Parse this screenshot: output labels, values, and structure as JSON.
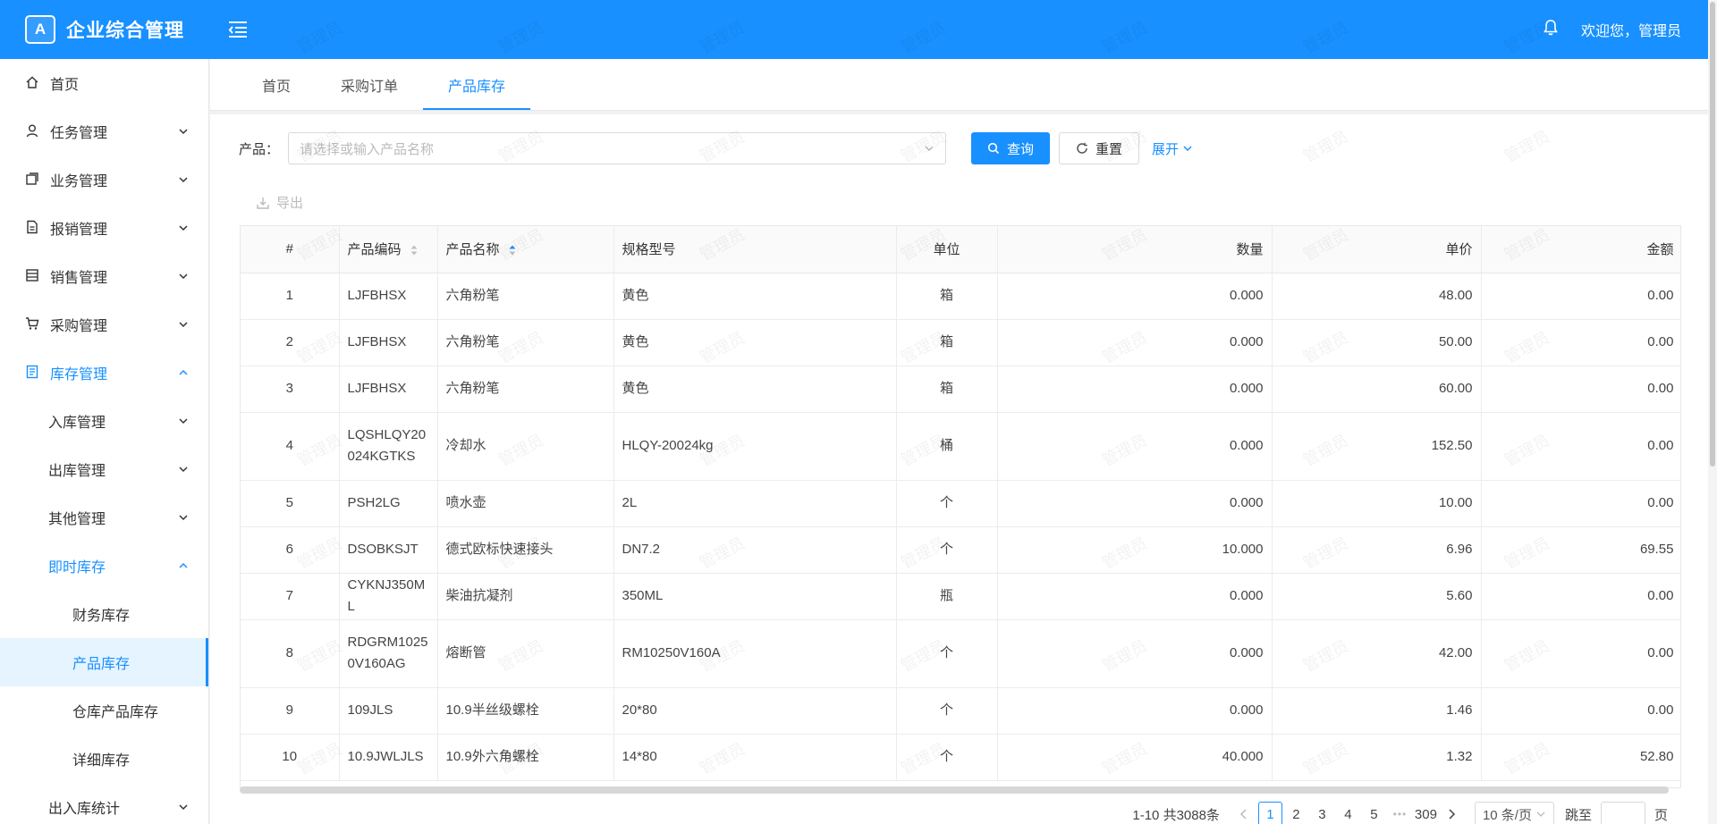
{
  "header": {
    "logo_badge": "A",
    "title": "企业综合管理",
    "welcome": "欢迎您，管理员"
  },
  "sidebar": {
    "items": [
      {
        "label": "首页",
        "icon": "home-icon",
        "level": 0,
        "arrow": "",
        "state": ""
      },
      {
        "label": "任务管理",
        "icon": "user-icon",
        "level": 0,
        "arrow": "down",
        "state": ""
      },
      {
        "label": "业务管理",
        "icon": "copy-icon",
        "level": 0,
        "arrow": "down",
        "state": ""
      },
      {
        "label": "报销管理",
        "icon": "file-icon",
        "level": 0,
        "arrow": "down",
        "state": ""
      },
      {
        "label": "销售管理",
        "icon": "database-icon",
        "level": 0,
        "arrow": "down",
        "state": ""
      },
      {
        "label": "采购管理",
        "icon": "cart-icon",
        "level": 0,
        "arrow": "down",
        "state": ""
      },
      {
        "label": "库存管理",
        "icon": "inventory-icon",
        "level": 0,
        "arrow": "up",
        "state": "open"
      },
      {
        "label": "入库管理",
        "icon": "",
        "level": 1,
        "arrow": "down",
        "state": ""
      },
      {
        "label": "出库管理",
        "icon": "",
        "level": 1,
        "arrow": "down",
        "state": ""
      },
      {
        "label": "其他管理",
        "icon": "",
        "level": 1,
        "arrow": "down",
        "state": ""
      },
      {
        "label": "即时库存",
        "icon": "",
        "level": 1,
        "arrow": "up",
        "state": "open"
      },
      {
        "label": "财务库存",
        "icon": "",
        "level": 2,
        "arrow": "",
        "state": ""
      },
      {
        "label": "产品库存",
        "icon": "",
        "level": 2,
        "arrow": "",
        "state": "active"
      },
      {
        "label": "仓库产品库存",
        "icon": "",
        "level": 2,
        "arrow": "",
        "state": ""
      },
      {
        "label": "详细库存",
        "icon": "",
        "level": 2,
        "arrow": "",
        "state": ""
      },
      {
        "label": "出入库统计",
        "icon": "",
        "level": 1,
        "arrow": "down",
        "state": ""
      }
    ]
  },
  "tabs": [
    {
      "label": "首页",
      "active": false
    },
    {
      "label": "采购订单",
      "active": false
    },
    {
      "label": "产品库存",
      "active": true
    }
  ],
  "filter": {
    "label": "产品：",
    "placeholder": "请选择或输入产品名称",
    "query_label": "查询",
    "reset_label": "重置",
    "expand_label": "展开"
  },
  "toolbar": {
    "export_label": "导出"
  },
  "table": {
    "columns": [
      "#",
      "产品编码",
      "产品名称",
      "规格型号",
      "单位",
      "数量",
      "单价",
      "金额"
    ],
    "rows": [
      [
        "1",
        "LJFBHSX",
        "六角粉笔",
        "黄色",
        "箱",
        "0.000",
        "48.00",
        "0.00"
      ],
      [
        "2",
        "LJFBHSX",
        "六角粉笔",
        "黄色",
        "箱",
        "0.000",
        "50.00",
        "0.00"
      ],
      [
        "3",
        "LJFBHSX",
        "六角粉笔",
        "黄色",
        "箱",
        "0.000",
        "60.00",
        "0.00"
      ],
      [
        "4",
        "LQSHLQY20024KGTKS",
        "冷却水",
        "HLQY-20024kg",
        "桶",
        "0.000",
        "152.50",
        "0.00"
      ],
      [
        "5",
        "PSH2LG",
        "喷水壶",
        "2L",
        "个",
        "0.000",
        "10.00",
        "0.00"
      ],
      [
        "6",
        "DSOBKSJT",
        "德式欧标快速接头",
        "DN7.2",
        "个",
        "10.000",
        "6.96",
        "69.55"
      ],
      [
        "7",
        "CYKNJ350ML",
        "柴油抗凝剂",
        "350ML",
        "瓶",
        "0.000",
        "5.60",
        "0.00"
      ],
      [
        "8",
        "RDGRM10250V160AG",
        "熔断管",
        "RM10250V160A",
        "个",
        "0.000",
        "42.00",
        "0.00"
      ],
      [
        "9",
        "109JLS",
        "10.9半丝级螺栓",
        "20*80",
        "个",
        "0.000",
        "1.46",
        "0.00"
      ],
      [
        "10",
        "10.9JWLJLS",
        "10.9外六角螺栓",
        "14*80",
        "个",
        "40.000",
        "1.32",
        "52.80"
      ]
    ]
  },
  "pagination": {
    "total": "1-10 共3088条",
    "pages": [
      "1",
      "2",
      "3",
      "4",
      "5"
    ],
    "ellipsis": "•••",
    "last_page": "309",
    "current": "1",
    "page_size": "10 条/页",
    "jump_label": "跳至",
    "page_suffix": "页"
  },
  "watermark": "管理员",
  "colors": {
    "primary": "#1890ff",
    "header_bg": "#1890ff",
    "active_bg": "#e6f4ff"
  }
}
